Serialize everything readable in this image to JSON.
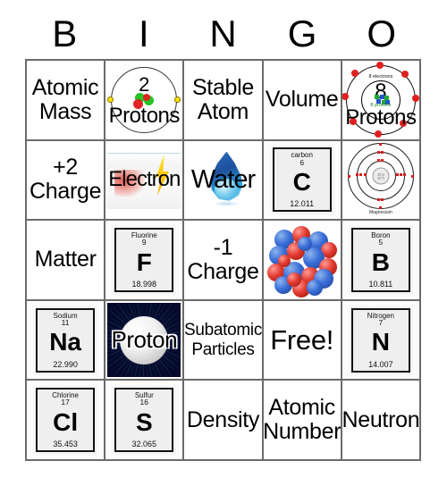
{
  "header": {
    "letters": [
      "B",
      "I",
      "N",
      "G",
      "O"
    ]
  },
  "grid": {
    "rows": [
      [
        {
          "kind": "text",
          "name": "cell-atomic-mass",
          "text": "Atomic\nMass"
        },
        {
          "kind": "bohr-helium",
          "name": "cell-2-protons",
          "number": "2",
          "label": "Protons"
        },
        {
          "kind": "text",
          "name": "cell-stable-atom",
          "text": "Stable\nAtom"
        },
        {
          "kind": "text",
          "name": "cell-volume",
          "text": "Volume"
        },
        {
          "kind": "bohr-oxygen",
          "name": "cell-8-protons",
          "number": "8",
          "label": "Protons",
          "ring_label_outer": "8 electrons",
          "ring_label_inner": "8 protons"
        }
      ],
      [
        {
          "kind": "text",
          "name": "cell-plus-2-charge",
          "text": "+2\nCharge"
        },
        {
          "kind": "electron",
          "name": "cell-electron",
          "text": "Electron"
        },
        {
          "kind": "water",
          "name": "cell-water",
          "text": "Water"
        },
        {
          "kind": "element",
          "name": "cell-element-carbon",
          "element_name": "carbon",
          "atomic_number": "6",
          "symbol": "C",
          "mass": "12.011"
        },
        {
          "kind": "bohr-magnesium",
          "name": "cell-magnesium-diagram",
          "caption": "Magnesium",
          "nucleus_line1": "12 p",
          "nucleus_line2": "12 n"
        }
      ],
      [
        {
          "kind": "text",
          "name": "cell-matter",
          "text": "Matter"
        },
        {
          "kind": "element",
          "name": "cell-element-fluorine",
          "element_name": "Fluorine",
          "atomic_number": "9",
          "symbol": "F",
          "mass": "18.998"
        },
        {
          "kind": "text",
          "name": "cell-minus-1-charge",
          "text": "-1\nCharge"
        },
        {
          "kind": "cluster",
          "name": "cell-nucleus-cluster"
        },
        {
          "kind": "element",
          "name": "cell-element-boron",
          "element_name": "Boron",
          "atomic_number": "5",
          "symbol": "B",
          "mass": "10.811"
        }
      ],
      [
        {
          "kind": "element",
          "name": "cell-element-sodium",
          "element_name": "Sodium",
          "atomic_number": "11",
          "symbol": "Na",
          "mass": "22.990"
        },
        {
          "kind": "proton",
          "name": "cell-proton",
          "text": "Proton"
        },
        {
          "kind": "text",
          "name": "cell-subatomic-particles",
          "text": "Subatomic\nParticles",
          "size": "small"
        },
        {
          "kind": "text",
          "name": "cell-free-space",
          "text": "Free!",
          "size": "free"
        },
        {
          "kind": "element",
          "name": "cell-element-nitrogen",
          "element_name": "Nitrogen",
          "atomic_number": "7",
          "symbol": "N",
          "mass": "14.007"
        }
      ],
      [
        {
          "kind": "element",
          "name": "cell-element-chlorine",
          "element_name": "Chlorine",
          "atomic_number": "17",
          "symbol": "Cl",
          "mass": "35.453"
        },
        {
          "kind": "element",
          "name": "cell-element-sulfur",
          "element_name": "Sulfur",
          "atomic_number": "16",
          "symbol": "S",
          "mass": "32.065"
        },
        {
          "kind": "text",
          "name": "cell-density",
          "text": "Density"
        },
        {
          "kind": "text",
          "name": "cell-atomic-number",
          "text": "Atomic\nNumber"
        },
        {
          "kind": "text",
          "name": "cell-neutron",
          "text": "Neutron"
        }
      ]
    ]
  },
  "colors": {
    "grid_line": "#6b6b6b",
    "text": "#000000",
    "electron_yellow": "#ffe400",
    "proton_red": "#e02424",
    "neutron_blue": "#3a6fd8",
    "water_blue": "#2a6fc4",
    "proton_bg": "#0a0f3c"
  }
}
